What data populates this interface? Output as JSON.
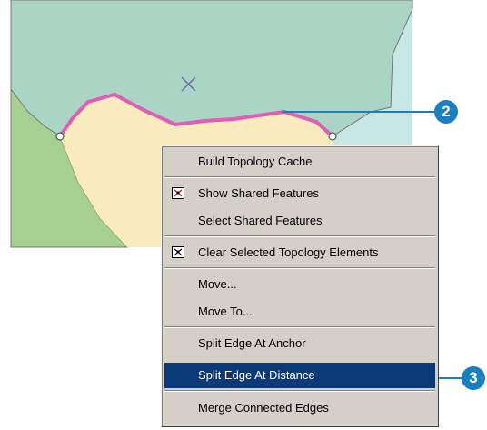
{
  "callouts": {
    "step_a": "2",
    "step_b": "3"
  },
  "context_menu": {
    "items": [
      {
        "label": "Build Topology Cache"
      },
      {
        "label": "Show Shared Features",
        "icon": "shared-features-icon"
      },
      {
        "label": "Select Shared Features"
      },
      {
        "label": "Clear Selected Topology Elements",
        "icon": "clear-topology-icon"
      },
      {
        "label": "Move..."
      },
      {
        "label": "Move To..."
      },
      {
        "label": "Split Edge At Anchor"
      },
      {
        "label": "Split Edge At Distance",
        "selected": true
      },
      {
        "label": "Merge Connected Edges"
      }
    ]
  },
  "colors": {
    "water": "#c9e6e6",
    "polygon_green": "#aad5c4",
    "polygon_left": "#a6cf92",
    "polygon_tan": "#faebbf",
    "selected_edge": "#e05cb5",
    "leader_line": "#1a7fc0",
    "menu_highlight": "#0b3a78"
  }
}
